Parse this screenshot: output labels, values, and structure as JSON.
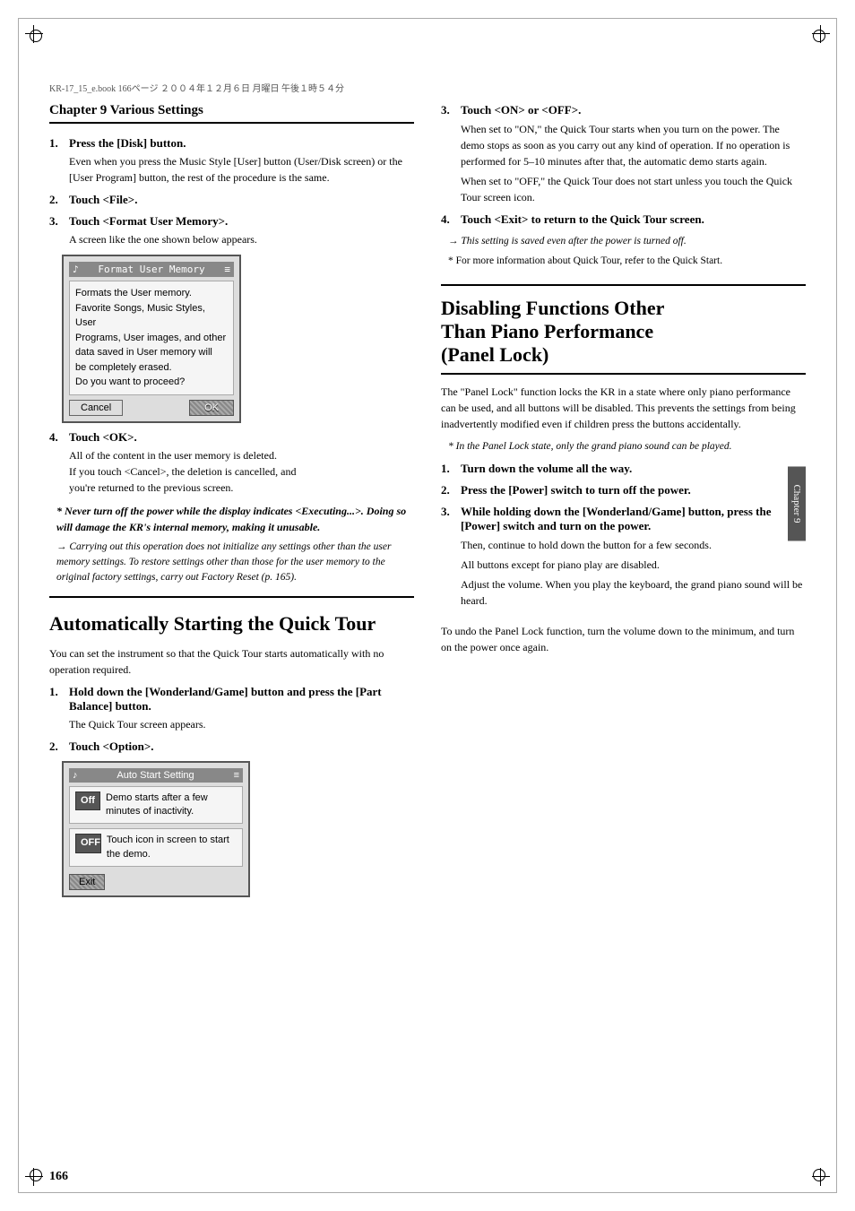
{
  "page": {
    "file_header": "KR-17_15_e.book  166ページ  ２００４年１２月６日  月曜日  午後１時５４分",
    "page_number": "166",
    "chapter_tab": "Chapter 9"
  },
  "left_column": {
    "chapter_heading": "Chapter 9 Various Settings",
    "steps_top": [
      {
        "num": "1.",
        "label": "Press the [Disk] button.",
        "body": "Even when you press the Music Style [User] button (User/Disk screen) or the [User Program] button, the rest of the procedure is the same."
      },
      {
        "num": "2.",
        "label": "Touch <File>.",
        "body": ""
      },
      {
        "num": "3.",
        "label": "Touch <Format User Memory>.",
        "body": "A screen like the one shown below appears."
      }
    ],
    "screen1": {
      "title": "Format User Memory",
      "body": "Formats the User memory.\nFavorite Songs, Music Styles, User\nPrograms, User images, and other\ndata saved in User memory will\nbe completely erased.\nDo you want to proceed?",
      "btn_cancel": "Cancel",
      "btn_ok": "OK"
    },
    "step4": {
      "num": "4.",
      "label": "Touch <OK>.",
      "body": "All of the content in the user memory is deleted.\nIf you touch <Cancel>, the deletion is cancelled, and\nyou're returned to the previous screen."
    },
    "note_bold": "Never turn off the power while the display indicates <Executing...>. Doing so will damage the KR's internal memory, making it unusable.",
    "note_arrow": "Carrying out this operation does not initialize any settings other than the user memory settings. To restore settings other than those for the user memory to the original factory settings, carry out Factory Reset (p. 165).",
    "section_title": "Automatically Starting the Quick Tour",
    "section_body": "You can set the instrument so that the Quick Tour starts automatically with no operation required.",
    "steps_bottom": [
      {
        "num": "1.",
        "label": "Hold down the [Wonderland/Game] button and press the [Part Balance] button.",
        "body": "The Quick Tour screen appears."
      },
      {
        "num": "2.",
        "label": "Touch <Option>.",
        "body": ""
      }
    ],
    "screen2": {
      "title": "Auto Start Setting",
      "row1_btn": "Off",
      "row1_text": "Demo starts after a few minutes of inactivity.",
      "row2_btn": "OFF",
      "row2_text": "Touch icon in screen to start the demo.",
      "btn_exit": "Exit"
    }
  },
  "right_column": {
    "step3": {
      "num": "3.",
      "label": "Touch <ON> or <OFF>.",
      "body_1": "When set to \"ON,\" the Quick Tour starts when you turn on the power. The demo stops as soon as you carry out any kind of operation. If no operation is performed for 5–10 minutes after that, the automatic demo starts again.",
      "body_2": "When set to \"OFF,\" the Quick Tour does not start unless you touch the Quick Tour screen icon."
    },
    "step4": {
      "num": "4.",
      "label": "Touch <Exit> to return to the Quick Tour screen.",
      "body": ""
    },
    "note_arrow": "This setting is saved even after the power is turned off.",
    "note_star": "For more information about Quick Tour, refer to the Quick Start.",
    "section_title_1": "Disabling Functions Other",
    "section_title_2": "Than Piano Performance",
    "section_title_3": "(Panel Lock)",
    "section_body": "The \"Panel Lock\" function locks the KR in a state where only piano performance can be used, and all buttons will be disabled. This prevents the settings from being inadvertently modified even if children press the buttons accidentally.",
    "note_star_italic": "In the Panel Lock state, only the grand piano sound can be played.",
    "steps": [
      {
        "num": "1.",
        "label": "Turn down the volume all the way.",
        "body": ""
      },
      {
        "num": "2.",
        "label": "Press the [Power] switch to turn off the power.",
        "body": ""
      },
      {
        "num": "3.",
        "label": "While holding down the [Wonderland/Game] button, press the [Power] switch and turn on the power.",
        "body_1": "Then, continue to hold down the button for a few seconds.",
        "body_2": "All buttons except for piano play are disabled.",
        "body_3": "Adjust the volume. When you play the keyboard, the grand piano sound will be heard."
      }
    ],
    "footer_text": "To undo the Panel Lock function, turn the volume down to the minimum, and turn on the power once again."
  }
}
